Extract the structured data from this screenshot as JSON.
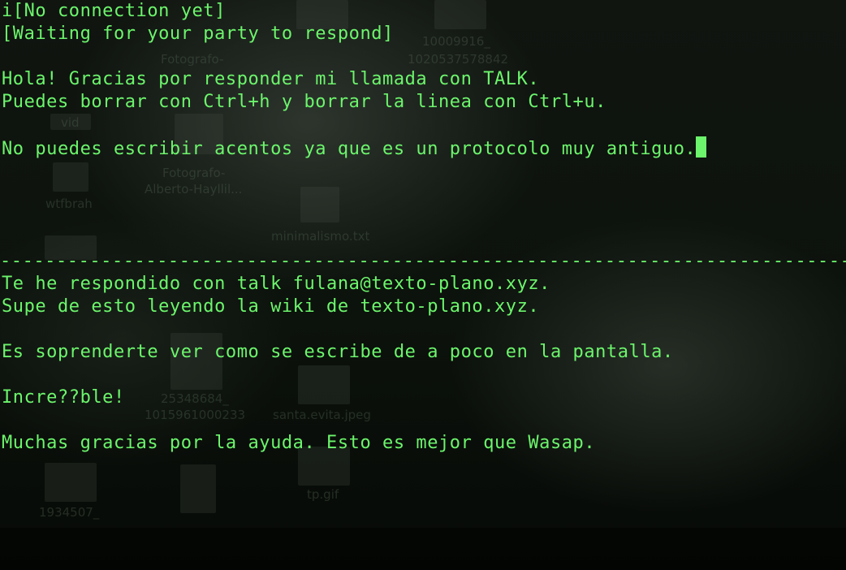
{
  "desktop": {
    "labels": [
      "10009916_",
      "1020537578842",
      "Fotografo-",
      "vid",
      "Fotografo-",
      "Alberto-Hayllil...",
      "wtfbrah",
      "minimalismo.txt",
      "25348684_",
      "1015961000233",
      "santa.evita.jpeg",
      "1934507_",
      "tp.gif"
    ]
  },
  "terminal": {
    "status_line_1": "i[No connection yet]",
    "status_line_2": "[Waiting for your party to respond]",
    "top_pane": {
      "lines": [
        "Hola! Gracias por responder mi llamada con TALK.",
        "Puedes borrar con Ctrl+h y borrar la linea con Ctrl+u.",
        "",
        "No puedes escribir acentos ya que es un protocolo muy antiguo."
      ]
    },
    "divider": "------------------------------------------------------------------------------------------------",
    "bottom_pane": {
      "lines": [
        "Te he respondido con talk fulana@texto-plano.xyz.",
        "Supe de esto leyendo la wiki de texto-plano.xyz.",
        "",
        "Es soprenderte ver como se escribe de a poco en la pantalla.",
        "",
        "Incre??ble!",
        "",
        "Muchas gracias por la ayuda. Esto es mejor que Wasap."
      ]
    },
    "colors": {
      "text": "#6cf56c",
      "background": "#0c120c"
    }
  }
}
